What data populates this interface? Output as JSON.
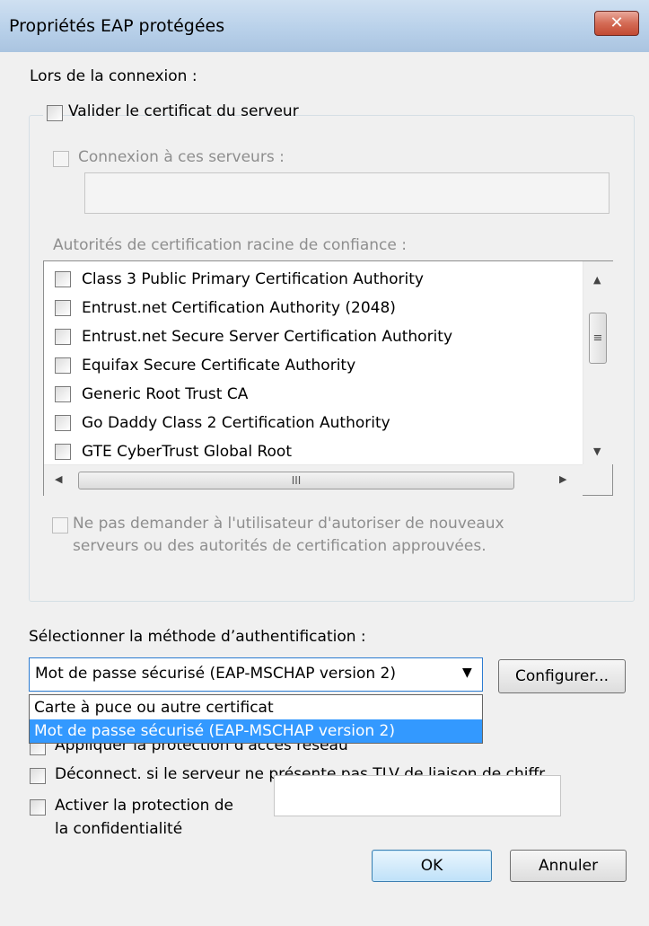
{
  "window": {
    "title": "Propriétés EAP protégées",
    "close_label": "✕"
  },
  "connection": {
    "heading": "Lors de la connexion :",
    "validate_cert_label": "Valider le certificat du serveur",
    "connect_servers_label": "Connexion à ces serveurs :",
    "servers_value": "",
    "trusted_ca_heading": "Autorités de certification racine de confiance :",
    "ca_items": [
      "Class 3 Public Primary Certification Authority",
      "Entrust.net Certification Authority (2048)",
      "Entrust.net Secure Server Certification Authority",
      "Equifax Secure Certificate Authority",
      "Generic Root Trust CA",
      "Go Daddy Class 2 Certification Authority",
      "GTE CyberTrust Global Root"
    ],
    "scroll_up": "▲",
    "scroll_down": "▼",
    "scroll_left": "◀",
    "scroll_right": "▶",
    "vthumb_grip": "≡",
    "hthumb_grip": "III",
    "no_prompt_line1": "Ne pas demander à l'utilisateur d'autoriser de nouveaux",
    "no_prompt_line2": "serveurs ou des autorités de certification approuvées."
  },
  "auth": {
    "heading": "Sélectionner la méthode d’authentification :",
    "selected": "Mot de passe sécurisé (EAP-MSCHAP version 2)",
    "dropdown_arrow": "▼",
    "options": [
      "Carte à puce ou autre certificat",
      "Mot de passe sécurisé (EAP-MSCHAP version 2)"
    ],
    "configure_label": "Configurer..."
  },
  "options": {
    "nap_label": "Appliquer la protection d'accès réseau",
    "disconnect_label": "Déconnect. si le serveur ne présente pas TLV de liaison de chiffr.",
    "privacy_line1": "Activer la protection de",
    "privacy_line2": "la confidentialité",
    "privacy_value": ""
  },
  "buttons": {
    "ok": "OK",
    "cancel": "Annuler"
  }
}
